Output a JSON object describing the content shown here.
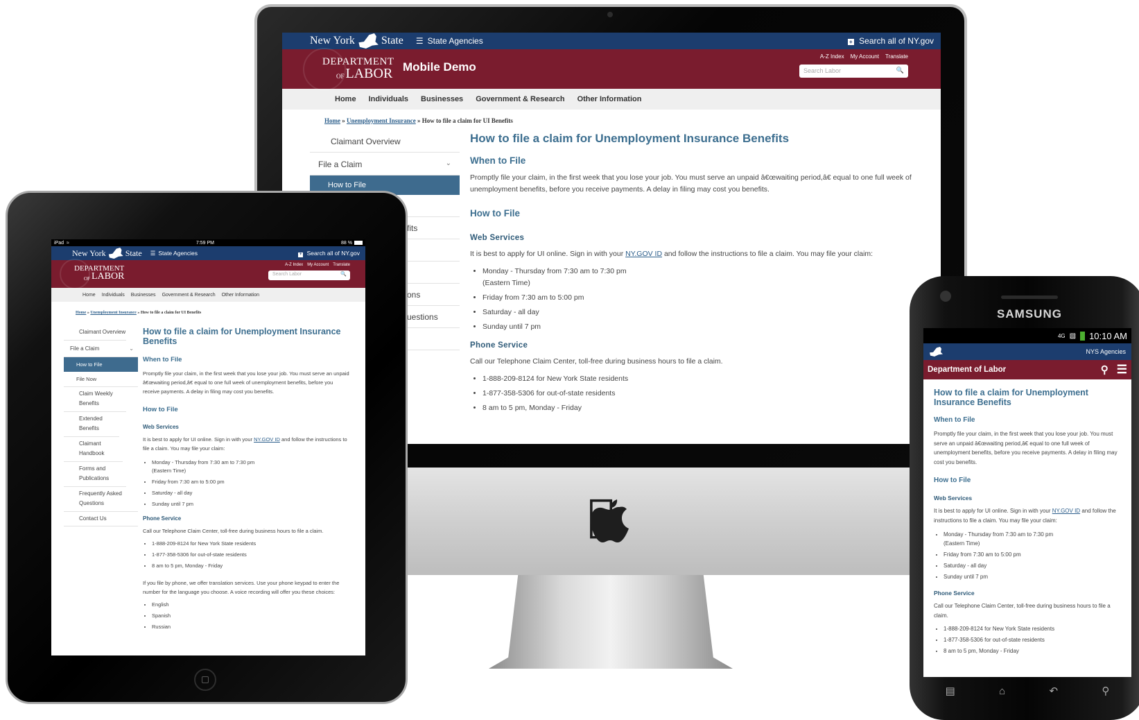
{
  "site": {
    "ny_left": "New York",
    "ny_right": "State",
    "state_agencies": "State Agencies",
    "search_all": "Search all of NY.gov",
    "utility_links": [
      "A-Z Index",
      "My Account",
      "Translate"
    ],
    "search_placeholder": "Search Labor",
    "logo_top": "Department",
    "logo_mid": "of",
    "logo_bottom": "Labor",
    "site_title": "Mobile Demo",
    "nav": [
      "Home",
      "Individuals",
      "Businesses",
      "Government & Research",
      "Other Information"
    ]
  },
  "breadcrumb": {
    "home": "Home",
    "section": "Unemployment Insurance",
    "current": "How to file a claim for UI Benefits",
    "sep": "»"
  },
  "sidebar": {
    "items": [
      "Claimant Overview",
      "File a Claim",
      "How to File",
      "File Now",
      "Claim Weekly Benefits",
      "Extended Benefits",
      "Claimant Handbook",
      "Forms and Publications",
      "Frequently Asked Questions",
      "Contact Us"
    ],
    "imac_visible": {
      "item_1": "Claimant Overview",
      "item_2": "File a Claim",
      "active_partial": "How to File",
      "frag_1": "fits",
      "frag_2": "ons",
      "frag_3": "uestions"
    }
  },
  "content": {
    "title": "How to file a claim for Unemployment Insurance Benefits",
    "when_heading": "When to File",
    "when_text": "Promptly file your claim, in the first week that you lose your job. You must serve an unpaid â€œwaiting period,â€ equal to one full week of unemployment benefits, before you receive payments. A delay in filing may cost you benefits.",
    "how_heading": "How to File",
    "web_heading": "Web Services",
    "web_text_before": "It is best to apply for UI online. Sign in with your",
    "web_link": "NY.GOV ID",
    "web_text_after": "and follow the instructions to file a claim.  You may file your claim:",
    "web_hours": [
      "Monday - Thursday from 7:30 am to 7:30 pm",
      "Friday from 7:30 am to 5:00 pm",
      "Saturday - all day",
      "Sunday until 7 pm"
    ],
    "eastern_time": "(Eastern Time)",
    "phone_heading": "Phone Service",
    "phone_text": "Call our Telephone Claim Center, toll-free during business hours to file a claim.",
    "phone_numbers": [
      "1-888-209-8124 for New York State residents",
      "1-877-358-5306 for out-of-state residents",
      "8 am to 5 pm, Monday - Friday"
    ],
    "translation_text": "If you file by phone, we offer translation services. Use your phone keypad to enter the number for the language you choose.  A voice recording will offer you these choices:",
    "languages": [
      "English",
      "Spanish",
      "Russian"
    ]
  },
  "ipad": {
    "carrier": "iPad",
    "time": "7:59 PM",
    "battery": "88 %"
  },
  "phone": {
    "brand": "SAMSUNG",
    "network": "4G",
    "time": "10:10 AM",
    "agencies": "NYS Agencies",
    "dept_title": "Department of Labor"
  },
  "icons": {
    "list": "list-icon",
    "plus": "plus-box-icon",
    "search": "search-icon",
    "menu": "hamburger-menu-icon",
    "chevron": "chevron-down-icon",
    "apple": "apple-logo-icon"
  },
  "colors": {
    "ny_blue": "#1c3d6e",
    "dol_maroon": "#7a1c2e",
    "heading_blue": "#3c6e8f",
    "active_nav": "#3e6b8e"
  }
}
